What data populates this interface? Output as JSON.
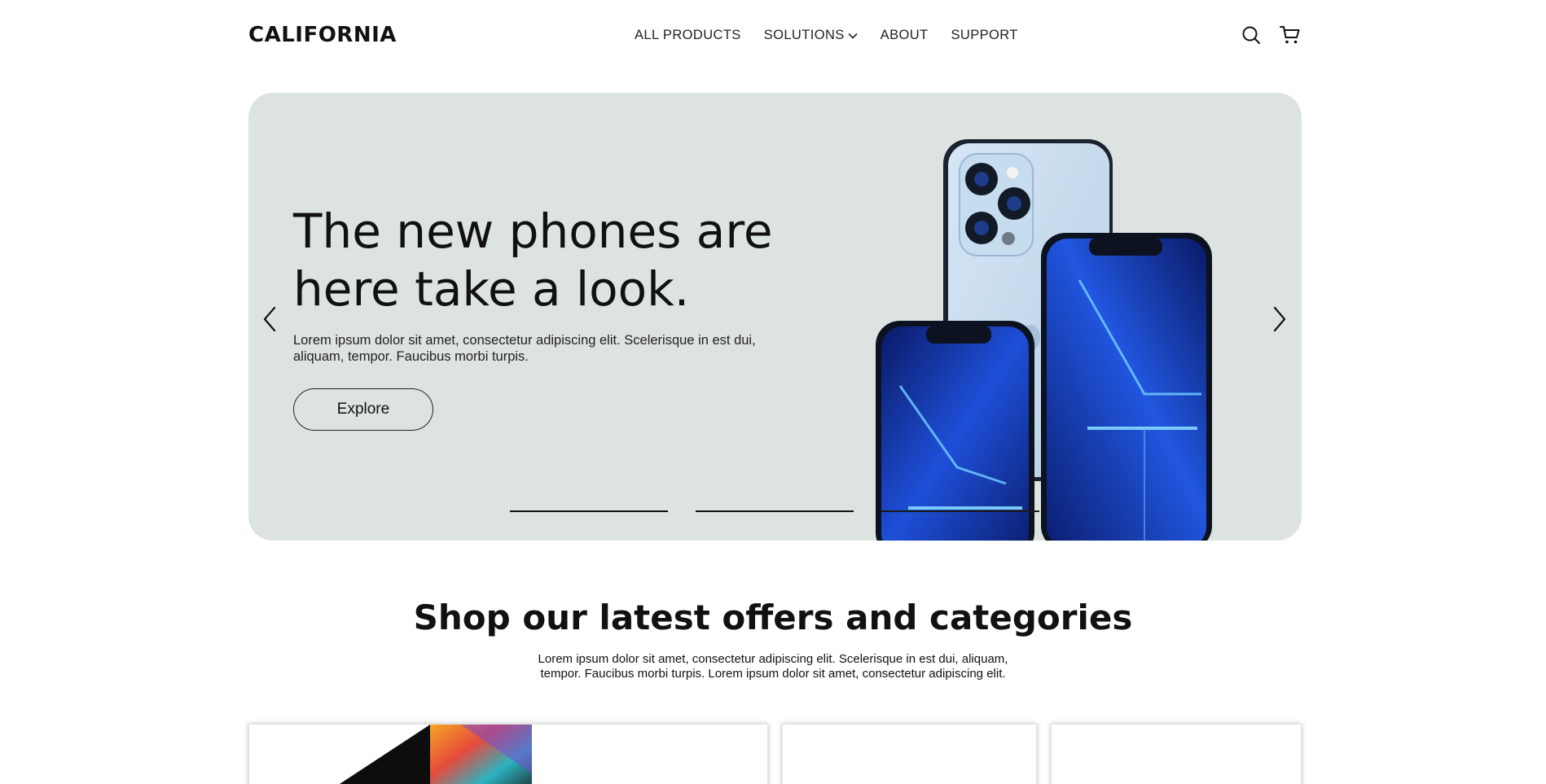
{
  "header": {
    "logo": "CALIFORNIA",
    "nav": {
      "all_products": "ALL PRODUCTS",
      "solutions": "SOLUTIONS",
      "about": "ABOUT",
      "support": "SUPPORT"
    },
    "icons": [
      "search-icon",
      "cart-icon"
    ]
  },
  "hero": {
    "title_line1": "The new phones are",
    "title_line2": "here take a look.",
    "subtitle": "Lorem ipsum dolor sit amet, consectetur adipiscing elit. Scelerisque in est dui, aliquam, tempor. Faucibus morbi turpis.",
    "cta_label": "Explore",
    "slide_count": 3,
    "background_color": "#dde3e1"
  },
  "section": {
    "title": "Shop our latest offers and categories",
    "subtitle_line1": "Lorem ipsum dolor sit amet, consectetur adipiscing elit. Scelerisque in est dui, aliquam,",
    "subtitle_line2": "tempor. Faucibus morbi turpis. Lorem ipsum dolor sit amet, consectetur adipiscing elit."
  }
}
